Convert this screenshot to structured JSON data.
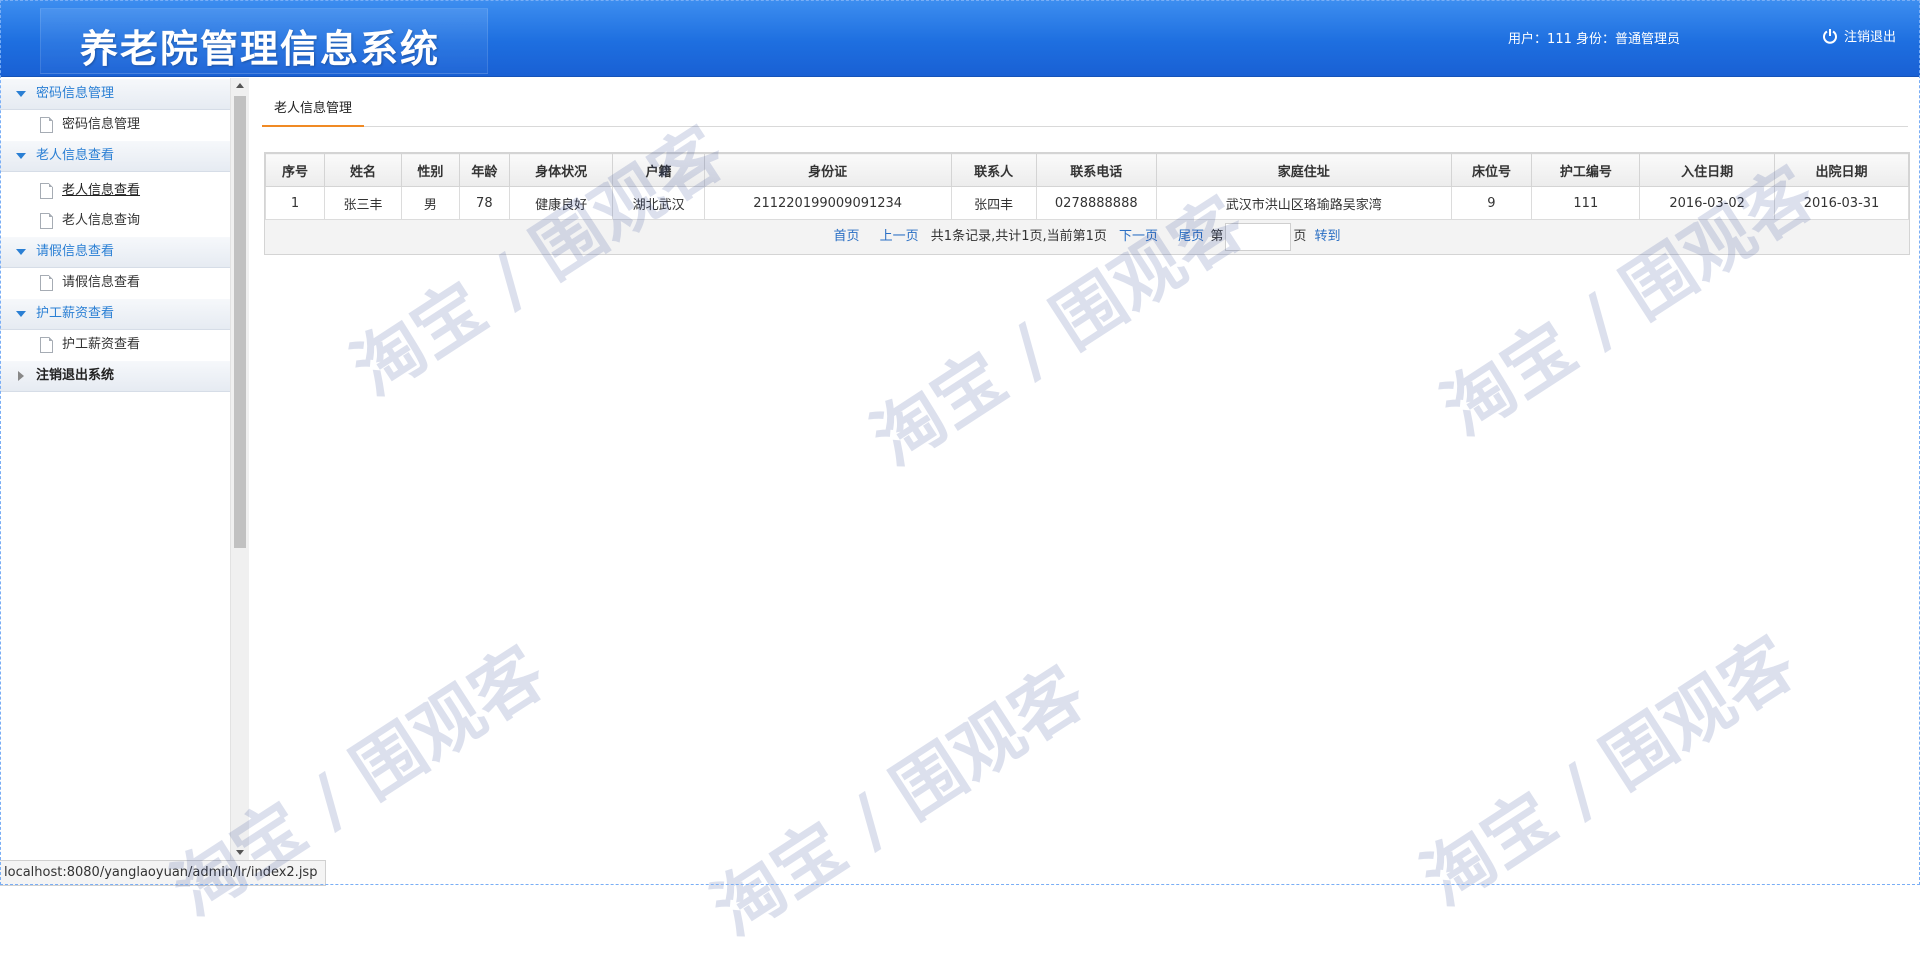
{
  "header": {
    "app_title": "养老院管理信息系统",
    "user_info": "用户：111 身份：普通管理员",
    "logout_label": "注销退出"
  },
  "sidebar": {
    "groups": [
      {
        "label": "密码信息管理",
        "items": [
          {
            "label": "密码信息管理"
          }
        ]
      },
      {
        "label": "老人信息查看",
        "items": [
          {
            "label": "老人信息查看"
          },
          {
            "label": "老人信息查询"
          }
        ]
      },
      {
        "label": "请假信息查看",
        "items": [
          {
            "label": "请假信息查看"
          }
        ]
      },
      {
        "label": "护工薪资查看",
        "items": [
          {
            "label": "护工薪资查看"
          }
        ]
      },
      {
        "label": "注销退出系统",
        "items": []
      }
    ]
  },
  "main": {
    "tab_label": "老人信息管理",
    "table": {
      "columns": [
        "序号",
        "姓名",
        "性别",
        "年龄",
        "身体状况",
        "户籍",
        "身份证",
        "联系人",
        "联系电话",
        "家庭住址",
        "床位号",
        "护工编号",
        "入住日期",
        "出院日期"
      ],
      "rows": [
        [
          "1",
          "张三丰",
          "男",
          "78",
          "健康良好",
          "湖北武汉",
          "211220199009091234",
          "张四丰",
          "0278888888",
          "武汉市洪山区珞瑜路吴家湾",
          "9",
          "111",
          "2016-03-02",
          "2016-03-31"
        ]
      ]
    },
    "pager": {
      "first": "首页",
      "prev": "上一页",
      "summary": "共1条记录,共计1页,当前第1页",
      "next": "下一页",
      "last": "尾页",
      "page_prefix": "第",
      "page_suffix": "页",
      "goto": "转到"
    }
  },
  "statusbar": {
    "url": "localhost:8080/yanglaoyuan/admin/lr/index2.jsp"
  },
  "watermark": {
    "text": "淘宝 / 围观客"
  },
  "colors": {
    "header_blue": "#1e6fe0",
    "menu_blue": "#2a7fd4",
    "tab_accent": "#f08a24",
    "link": "#2a6fc4"
  }
}
